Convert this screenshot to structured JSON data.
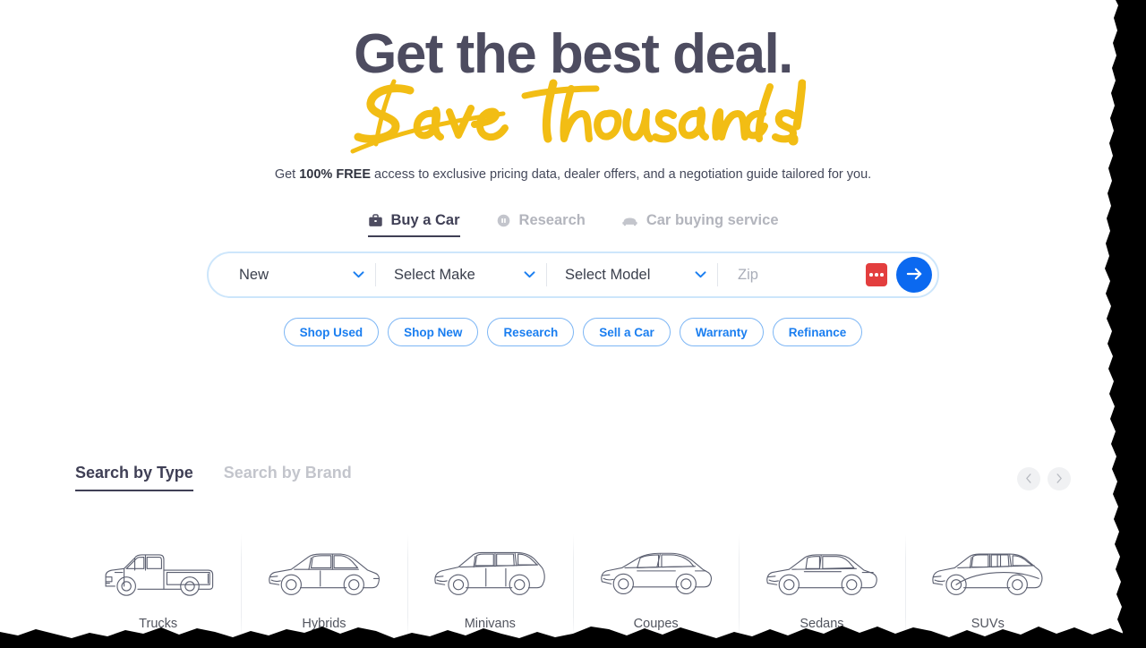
{
  "hero": {
    "headline": "Get the best deal.",
    "script_line": "Save thousands!",
    "subtitle_pre": "Get ",
    "subtitle_bold": "100% FREE",
    "subtitle_post": " access to exclusive pricing data, dealer offers, and a negotiation guide tailored for you."
  },
  "tabs": [
    {
      "label": "Buy a Car",
      "icon": "briefcase-icon",
      "active": true
    },
    {
      "label": "Research",
      "icon": "research-circle-icon",
      "active": false
    },
    {
      "label": "Car buying service",
      "icon": "car-service-icon",
      "active": false
    }
  ],
  "search": {
    "condition_value": "New",
    "make_value": "Select Make",
    "model_value": "Select Model",
    "zip_value": "",
    "zip_placeholder": "Zip",
    "submit_icon": "arrow-right-icon",
    "password_manager_icon": "password-manager-icon",
    "chevron_icon": "chevron-down-icon"
  },
  "quick_links": [
    {
      "label": "Shop Used"
    },
    {
      "label": "Shop New"
    },
    {
      "label": "Research"
    },
    {
      "label": "Sell a Car"
    },
    {
      "label": "Warranty"
    },
    {
      "label": "Refinance"
    }
  ],
  "browse": {
    "tabs": [
      {
        "label": "Search by Type",
        "active": true
      },
      {
        "label": "Search by Brand",
        "active": false
      }
    ],
    "prev_icon": "chevron-left-icon",
    "next_icon": "chevron-right-icon",
    "cards": [
      {
        "label": "Trucks",
        "art": "truck-illustration"
      },
      {
        "label": "Hybrids",
        "art": "hybrid-illustration"
      },
      {
        "label": "Minivans",
        "art": "minivan-illustration"
      },
      {
        "label": "Coupes",
        "art": "coupe-illustration"
      },
      {
        "label": "Sedans",
        "art": "sedan-illustration"
      },
      {
        "label": "SUVs",
        "art": "suv-illustration"
      }
    ]
  },
  "colors": {
    "headline": "#4d4c60",
    "script_yellow": "#f2bd14",
    "accent_blue": "#0b69f0",
    "pill_blue": "#1a7ef0",
    "red_badge": "#e33e3e",
    "muted": "#b3b5bd"
  }
}
